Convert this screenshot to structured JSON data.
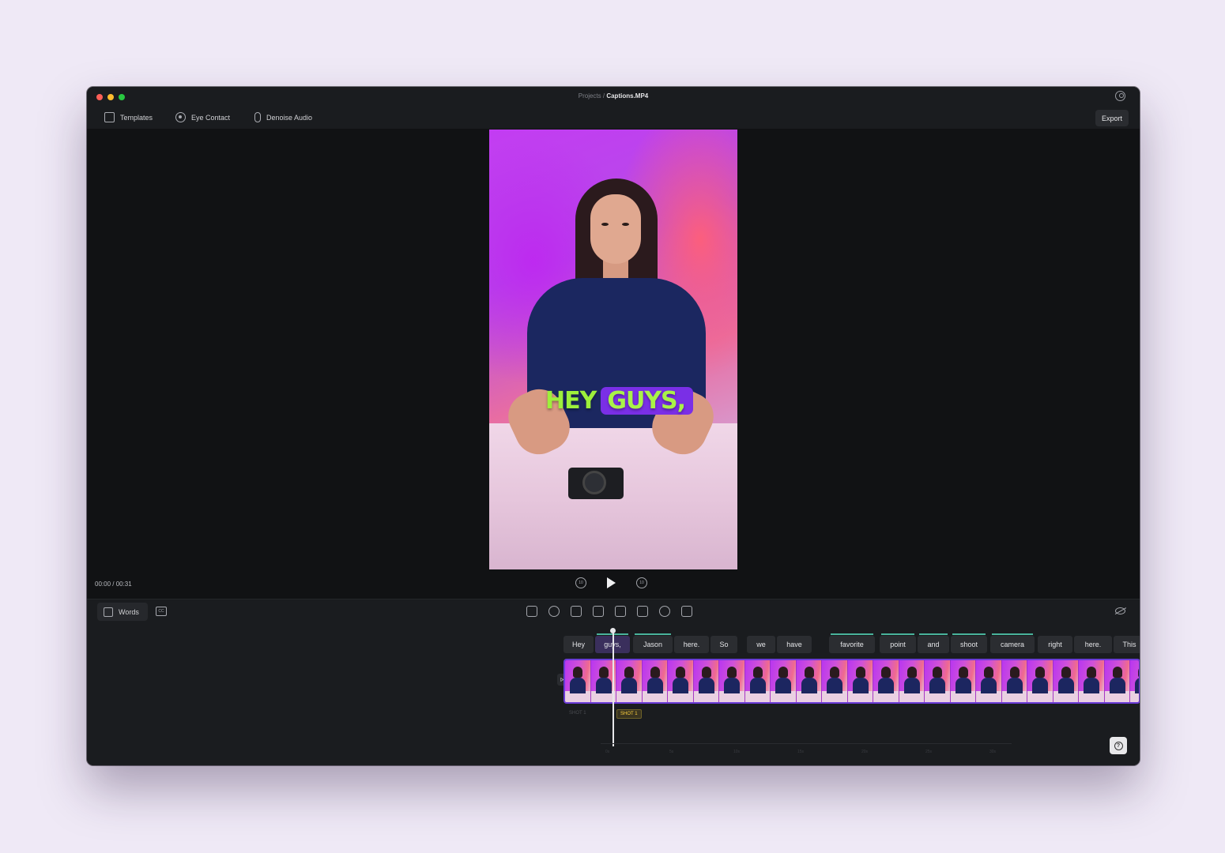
{
  "window": {
    "breadcrumb": "Projects /",
    "title": "Captions.MP4"
  },
  "toolbar": {
    "templates_label": "Templates",
    "eye_contact_label": "Eye Contact",
    "denoise_label": "Denoise Audio",
    "export_label": "Export"
  },
  "preview": {
    "caption_plain": "HEY",
    "caption_highlight": "GUYS,",
    "timecode": "00:00 / 00:31",
    "skip_back": "10",
    "skip_forward": "10"
  },
  "timeline": {
    "words_label": "Words",
    "cc_label": "CC",
    "words": [
      {
        "text": "Hey",
        "active": false,
        "mark": false
      },
      {
        "text": "guys,",
        "active": true,
        "mark": true
      },
      {
        "text": "Jason",
        "active": false,
        "mark": true
      },
      {
        "text": "here.",
        "active": false,
        "mark": false
      },
      {
        "text": "So",
        "active": false,
        "mark": false
      },
      {
        "text": "we",
        "active": false,
        "mark": false
      },
      {
        "text": "have",
        "active": false,
        "mark": false
      },
      {
        "text": "favorite",
        "active": false,
        "mark": true
      },
      {
        "text": "point",
        "active": false,
        "mark": true
      },
      {
        "text": "and",
        "active": false,
        "mark": true
      },
      {
        "text": "shoot",
        "active": false,
        "mark": true
      },
      {
        "text": "camera",
        "active": false,
        "mark": true
      },
      {
        "text": "right",
        "active": false,
        "mark": false
      },
      {
        "text": "here.",
        "active": false,
        "mark": false
      },
      {
        "text": "This",
        "active": false,
        "mark": false
      }
    ],
    "shot_dim": "SHOT 1",
    "shot_active": "SHOT 1",
    "ruler": [
      "0s",
      "5s",
      "10s",
      "15s",
      "20s",
      "25s",
      "30s"
    ],
    "help": "?"
  },
  "colors": {
    "accent": "#6a3bd6",
    "caption_green": "#9df03b",
    "caption_highlight": "#7a2fe6",
    "shot_label": "#ffd23e"
  }
}
